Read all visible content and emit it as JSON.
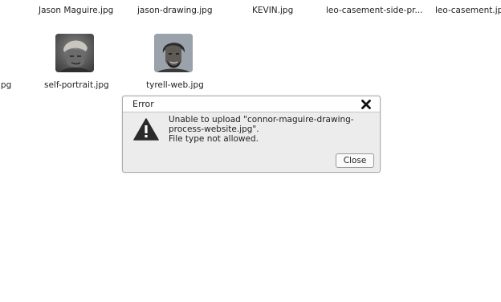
{
  "files_top_row": [
    "Jason Maguire.jpg",
    "jason-drawing.jpg",
    "KEVIN.jpg",
    "leo-casement-side-pr...",
    "leo-casement.jpg"
  ],
  "files_second_row": [
    "jpg",
    "self-portrait.jpg",
    "tyrell-web.jpg"
  ],
  "thumb_icons": [
    "portrait-thumbnail-icon",
    "portrait-thumbnail-icon"
  ],
  "dialog": {
    "title": "Error",
    "message_line1": "Unable to upload \"connor-maguire-drawing-",
    "message_line2": "process-website.jpg\".",
    "message_line3": "File type not allowed.",
    "close_label": "Close",
    "close_icon": "close-x-icon",
    "warning_icon": "warning-triangle-icon"
  },
  "colors": {
    "dialog_bg": "#ececec",
    "dialog_border": "#a9a9a9",
    "icon_dark": "#222222"
  }
}
